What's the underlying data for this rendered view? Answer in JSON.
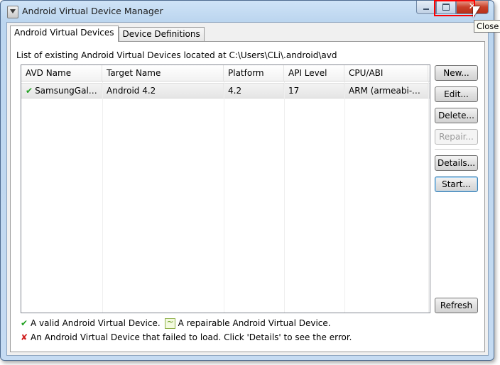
{
  "window": {
    "title": "Android Virtual Device Manager",
    "close_tooltip": "Close",
    "close_glyph": "✕"
  },
  "tabs": [
    {
      "label": "Android Virtual Devices",
      "active": true
    },
    {
      "label": "Device Definitions",
      "active": false
    }
  ],
  "list": {
    "caption": "List of existing Android Virtual Devices located at C:\\Users\\CLi\\.android\\avd",
    "columns": [
      "AVD Name",
      "Target Name",
      "Platform",
      "API Level",
      "CPU/ABI"
    ],
    "rows": [
      {
        "status_icon": "valid-check-icon",
        "avd_name": "SamsungGalax...",
        "target_name": "Android 4.2",
        "platform": "4.2",
        "api_level": "17",
        "cpu_abi": "ARM (armeabi-v..."
      }
    ]
  },
  "buttons": {
    "new": "New...",
    "edit": "Edit...",
    "delete": "Delete...",
    "repair": "Repair...",
    "details": "Details...",
    "start": "Start...",
    "refresh": "Refresh"
  },
  "legend": {
    "valid": "A valid Android Virtual Device.",
    "repairable": "A repairable Android Virtual Device.",
    "failed": "An Android Virtual Device that failed to load. Click 'Details' to see the error."
  },
  "colors": {
    "valid": "#20a020",
    "failed": "#d02020",
    "close_highlight": "#ff0000"
  }
}
